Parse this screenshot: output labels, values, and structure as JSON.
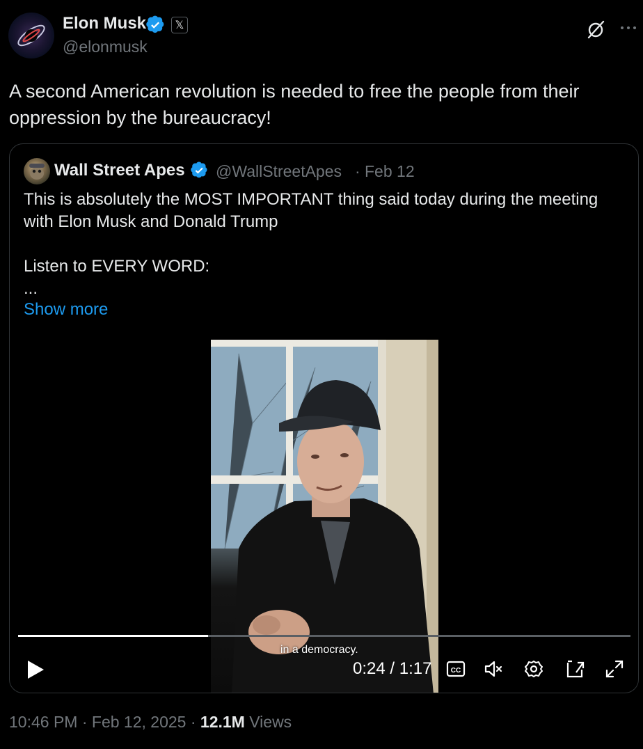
{
  "author": {
    "name": "Elon Musk",
    "handle": "@elonmusk",
    "badge_letter": "𝕏"
  },
  "tweet": {
    "text": "A second American revolution is needed to free the people from their oppression by the bureaucracy!"
  },
  "quote": {
    "name": "Wall Street Apes",
    "handle": "@WallStreetApes",
    "separator": "·",
    "date": "Feb 12",
    "text": "This is absolutely the MOST IMPORTANT thing said today during the meeting with Elon Musk and Donald Trump\n\nListen to EVERY WORD:\n...",
    "show_more": "Show more"
  },
  "video": {
    "caption": "in a democracy.",
    "time": "0:24 / 1:17",
    "progress_fraction": 0.31
  },
  "footer": {
    "time": "10:46 PM",
    "sep1": "·",
    "date": "Feb 12, 2025",
    "sep2": "·",
    "views_count": "12.1M",
    "views_label": "Views"
  },
  "icons": {
    "verified": "verified-badge-icon",
    "grok": "grok-icon",
    "more": "more-icon",
    "play": "play-icon",
    "cc": "closed-captions-icon",
    "mute": "muted-speaker-icon",
    "settings": "gear-icon",
    "pip": "picture-in-picture-icon",
    "fullscreen": "fullscreen-icon"
  },
  "colors": {
    "background": "#000000",
    "accent": "#1d9bf0",
    "muted_text": "#71767b",
    "primary_text": "#e7e9ea"
  }
}
